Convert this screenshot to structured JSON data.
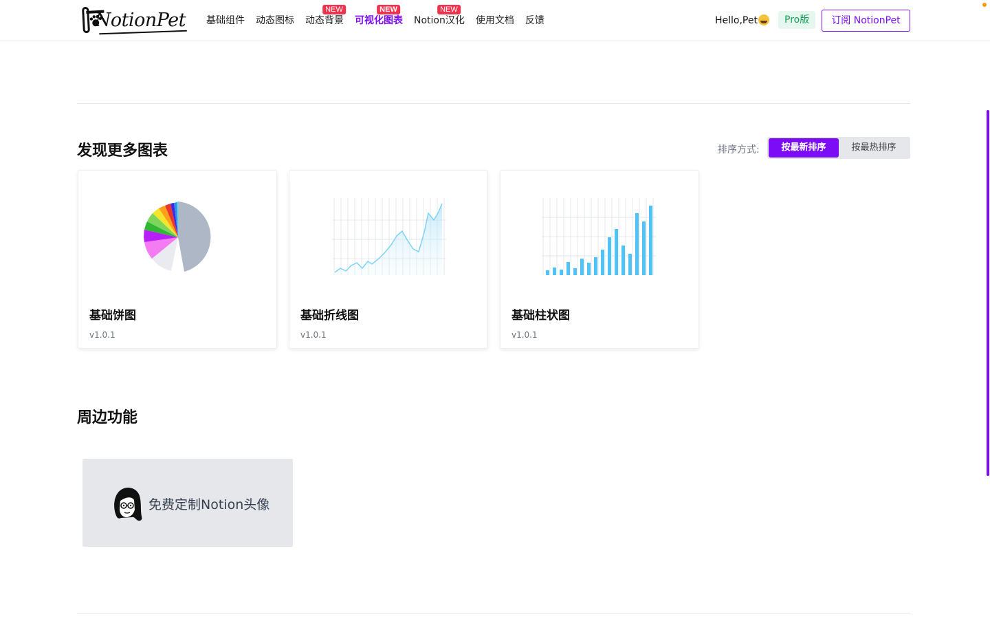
{
  "header": {
    "logo_text": "NotionPet",
    "nav": [
      {
        "label": "基础组件",
        "badge": ""
      },
      {
        "label": "动态图标",
        "badge": ""
      },
      {
        "label": "动态背景",
        "badge": "NEW"
      },
      {
        "label": "可视化图表",
        "badge": "NEW",
        "active": true
      },
      {
        "label": "Notion汉化",
        "badge": "NEW"
      },
      {
        "label": "使用文档",
        "badge": ""
      },
      {
        "label": "反馈",
        "badge": ""
      }
    ],
    "greeting": "Hello,Pet",
    "pro_label": "Pro版",
    "subscribe_label": "订阅 NotionPet"
  },
  "charts_section": {
    "title": "发现更多图表",
    "sort_label": "排序方式:",
    "sort_options": [
      "按最新排序",
      "按最热排序"
    ],
    "selected_sort": "按最新排序",
    "cards": [
      {
        "title": "基础饼图",
        "version": "v1.0.1",
        "icon": "pie-chart-thumbnail"
      },
      {
        "title": "基础折线图",
        "version": "v1.0.1",
        "icon": "line-chart-thumbnail"
      },
      {
        "title": "基础柱状图",
        "version": "v1.0.1",
        "icon": "bar-chart-thumbnail"
      }
    ]
  },
  "features_section": {
    "title": "周边功能",
    "avatar_card_label": "免费定制Notion头像",
    "avatar_icon": "cartoon-avatar-icon"
  },
  "colors": {
    "accent": "#7c0cf5",
    "badge": "#f0334d",
    "pro_text": "#16a05a",
    "bar": "#4fc3f7"
  }
}
